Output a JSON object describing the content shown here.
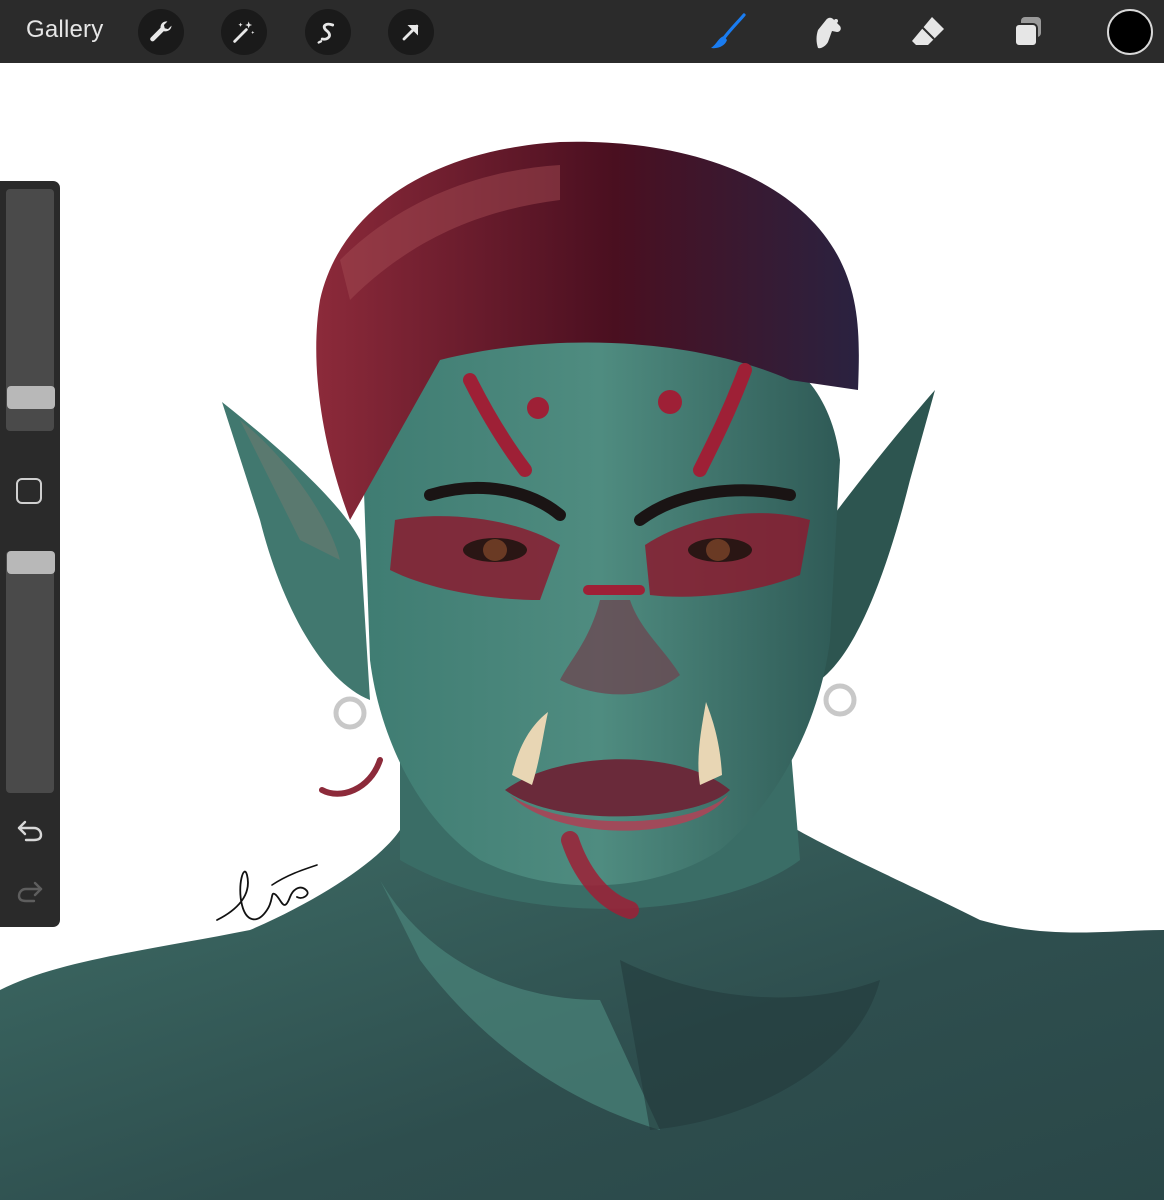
{
  "toolbar": {
    "gallery_label": "Gallery",
    "left_tools": [
      "wrench-icon",
      "magic-wand-icon",
      "selection-icon",
      "transform-arrow-icon"
    ],
    "right_tools": [
      "brush-icon",
      "smudge-icon",
      "eraser-icon",
      "layers-icon"
    ],
    "active_tool": "brush",
    "accent_color": "#1a7cf0",
    "current_color": "#000000"
  },
  "sidebar": {
    "brush_size_level": 0.1,
    "opacity_level": 1.0,
    "modify_button": "square-icon",
    "undo": "undo-icon",
    "redo": "redo-icon"
  },
  "canvas": {
    "background": "#ffffff",
    "artwork": "orc-portrait",
    "signature": "signature"
  }
}
